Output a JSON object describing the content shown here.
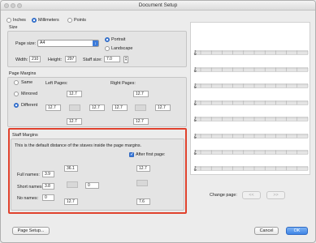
{
  "window": {
    "title": "Document Setup"
  },
  "units": {
    "inches": "Inches",
    "millimeters": "Millimeters",
    "points": "Points",
    "selected": "Millimeters"
  },
  "size": {
    "group_title": "Size",
    "page_size_label": "Page size:",
    "page_size_value": "A4",
    "portrait": "Portrait",
    "landscape": "Landscape",
    "orientation": "Portrait",
    "width_label": "Width:",
    "width_value": "210",
    "height_label": "Height:",
    "height_value": "297",
    "staff_size_label": "Staff size:",
    "staff_size_value": "7.0"
  },
  "page_margins": {
    "group_title": "Page Margins",
    "same": "Same",
    "mirrored": "Mirrored",
    "different": "Different",
    "selected": "Different",
    "left_pages": "Left Pages:",
    "right_pages": "Right Pages:",
    "left": {
      "top": "12.7",
      "left": "12.7",
      "right": "12.7",
      "bottom": "12.7"
    },
    "right": {
      "top": "12.7",
      "left": "12.7",
      "right": "12.7",
      "bottom": "12.7"
    }
  },
  "staff_margins": {
    "group_title": "Staff Margins",
    "description": "This is the default distance of the staves inside the page margins.",
    "after_first_page": "After first page:",
    "after_first_page_checked": true,
    "first_top": "36.1",
    "after_top": "12.7",
    "full_names_label": "Full names:",
    "full_names_value": "3.9",
    "short_names_label": "Short names:",
    "short_names_value": "3.8",
    "no_names_label": "No names:",
    "no_names_value": "0",
    "right_value": "0",
    "first_bottom": "12.7",
    "after_bottom": "7.6"
  },
  "preview": {
    "change_page_label": "Change page:",
    "prev": "<<",
    "next": ">>"
  },
  "buttons": {
    "page_setup": "Page Setup...",
    "cancel": "Cancel",
    "ok": "OK"
  },
  "colors": {
    "highlight": "#e0422d",
    "accent": "#3d7bd9"
  }
}
